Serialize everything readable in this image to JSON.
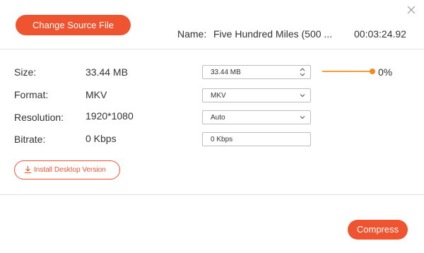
{
  "header": {
    "change_source_label": "Change Source File",
    "name_label": "Name:",
    "name_value": "Five Hundred Miles (500 ...",
    "duration": "00:03:24.92"
  },
  "rows": {
    "size": {
      "label": "Size:",
      "value": "33.44 MB",
      "field_value": "33.44  MB"
    },
    "format": {
      "label": "Format:",
      "value": "MKV",
      "field_value": "MKV"
    },
    "resolution": {
      "label": "Resolution:",
      "value": "1920*1080",
      "field_value": "Auto"
    },
    "bitrate": {
      "label": "Bitrate:",
      "value": "0 Kbps",
      "field_value": "0 Kbps"
    }
  },
  "slider": {
    "percent_label": "0%",
    "level": 1.0
  },
  "install_label": "Install Desktop Version",
  "compress_label": "Compress",
  "colors": {
    "accent": "#ef5431",
    "slider": "#f28a1f"
  },
  "icons": {
    "close": "close-icon",
    "stepper": "up-down-chevron-icon",
    "dropdown": "chevron-down-icon",
    "download": "download-icon"
  }
}
